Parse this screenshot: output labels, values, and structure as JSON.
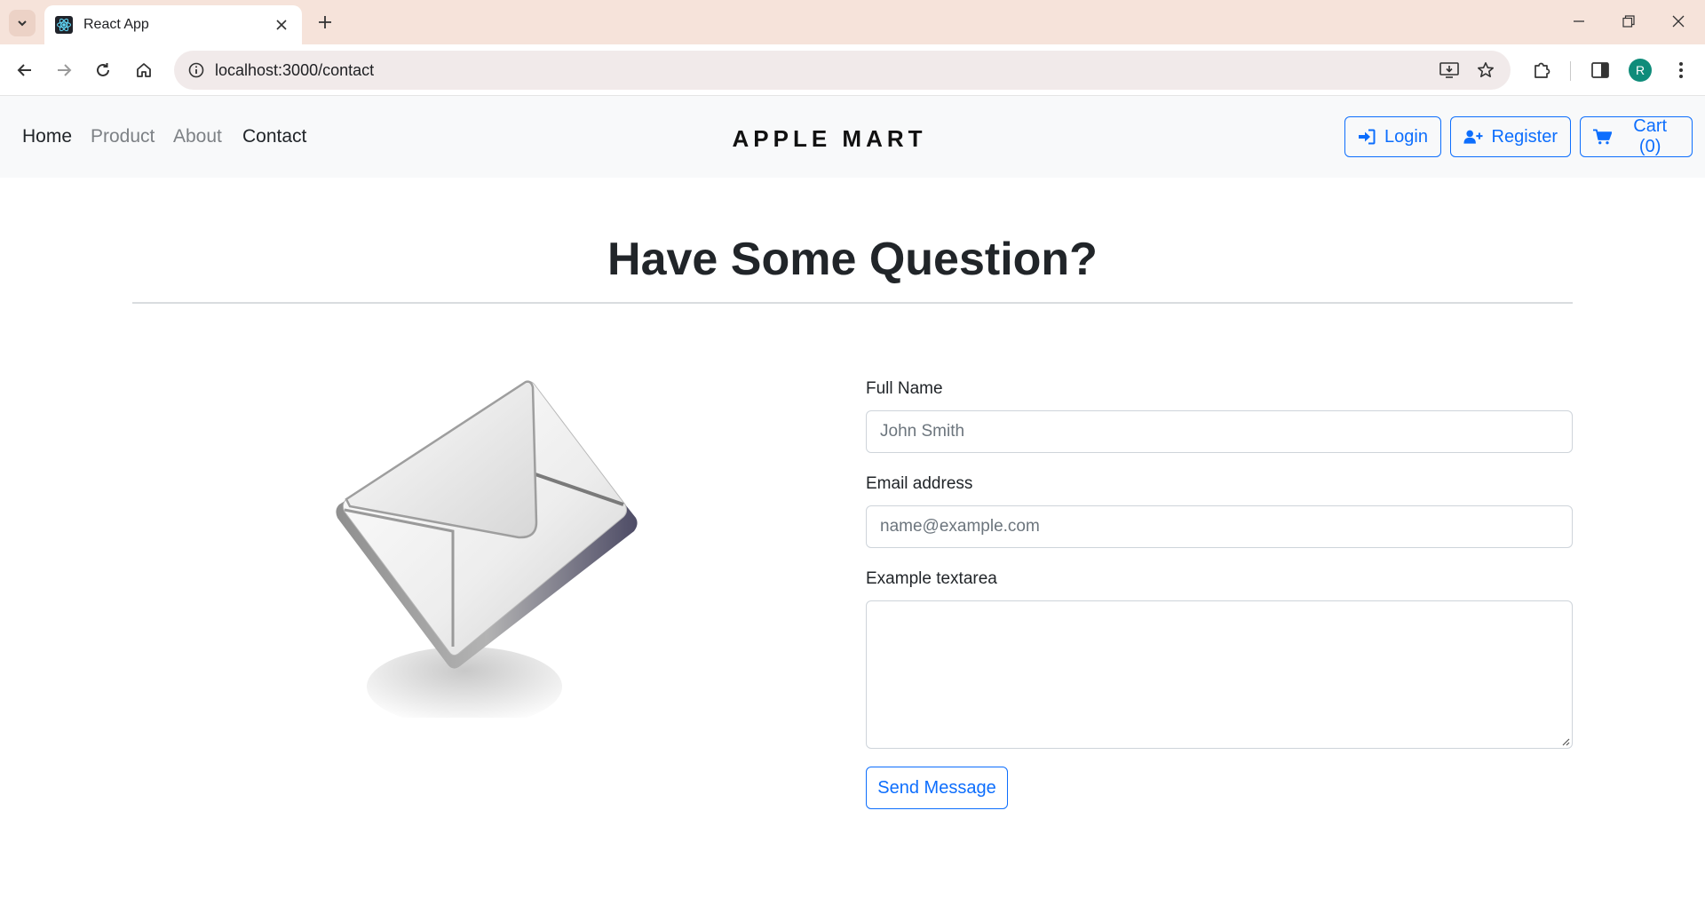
{
  "browser": {
    "tab_title": "React App",
    "url": "localhost:3000/contact",
    "profile_initial": "R",
    "favicon": "react-logo-icon"
  },
  "nav": {
    "links": [
      {
        "label": "Home",
        "color": "#212529"
      },
      {
        "label": "Product",
        "color": "#7d8185"
      },
      {
        "label": "About",
        "color": "#7d8185"
      },
      {
        "label": "Contact",
        "color": "#212529"
      }
    ],
    "brand": "APPLE MART",
    "login_label": "Login",
    "register_label": "Register",
    "cart_label": "Cart (0)"
  },
  "main": {
    "heading": "Have Some Question?",
    "form": {
      "name_label": "Full Name",
      "name_placeholder": "John Smith",
      "email_label": "Email address",
      "email_placeholder": "name@example.com",
      "message_label": "Example textarea",
      "message_value": "",
      "submit_label": "Send Message"
    }
  },
  "colors": {
    "accent": "#0d6efd",
    "chrome_tabstrip": "#f6e3da",
    "navbar_bg": "#f8f9fa"
  }
}
